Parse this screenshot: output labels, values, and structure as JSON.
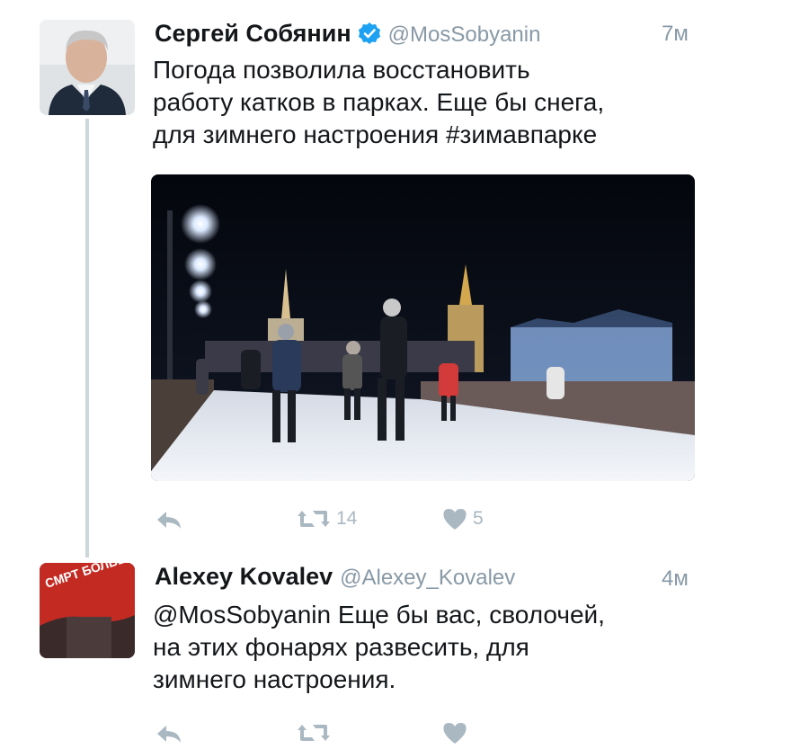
{
  "tweets": [
    {
      "author_name": "Сергей Собянин",
      "verified": true,
      "handle": "@MosSobyanin",
      "time": "7м",
      "text_lines": [
        "Погода позволила восстановить",
        "работу катков в парках. Еще бы снега,",
        "для зимнего настроения #зимавпарке"
      ],
      "actions": {
        "reply_icon": "reply-icon",
        "retweet_icon": "retweet-icon",
        "like_icon": "heart-icon",
        "retweets": "14",
        "likes": "5"
      }
    },
    {
      "author_name": "Alexey Kovalev",
      "verified": false,
      "handle": "@Alexey_Kovalev",
      "time": "4м",
      "text_lines": [
        "@MosSobyanin Еще бы вас, сволочей,",
        "на этих фонарях развесить, для",
        "зимнего настроения."
      ],
      "avatar_text": "СМРТ БОЛЬШЕВИЗМУ",
      "actions": {
        "reply_icon": "reply-icon",
        "retweet_icon": "retweet-icon",
        "like_icon": "heart-icon"
      }
    }
  ],
  "colors": {
    "text": "#14171a",
    "muted": "#8899a6",
    "icon": "#aab8c2",
    "verified": "#1da1f2",
    "thread_line": "#ccd6dd"
  }
}
